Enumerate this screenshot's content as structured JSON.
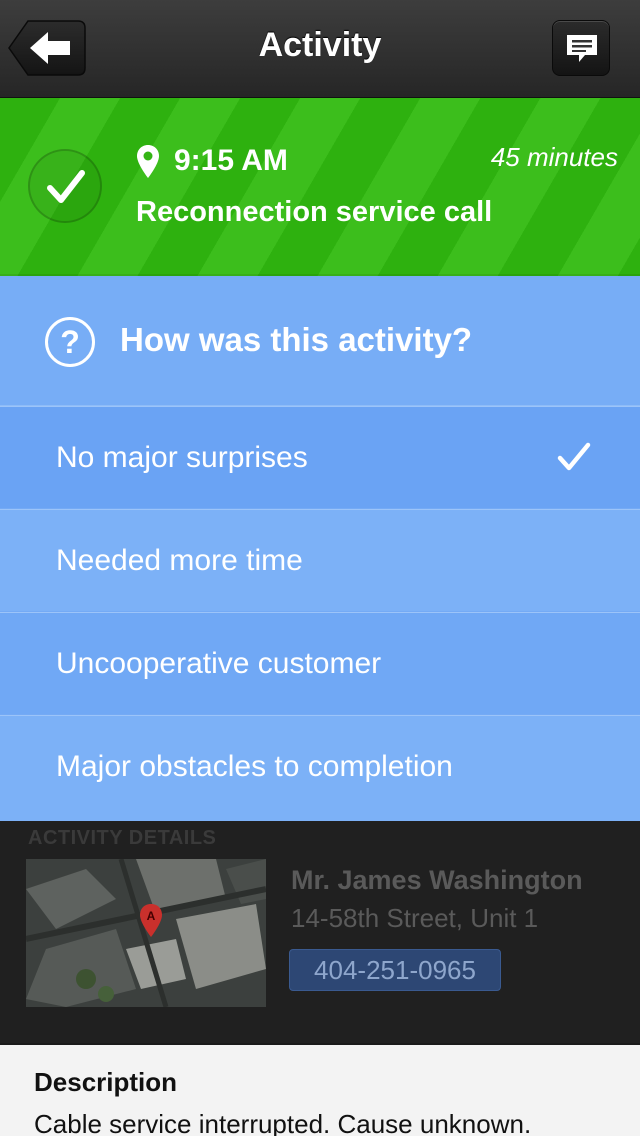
{
  "nav": {
    "title": "Activity",
    "back_icon": "arrow-left-icon",
    "message_icon": "speech-bubble-icon"
  },
  "activity": {
    "time": "9:15 AM",
    "duration": "45 minutes",
    "title": "Reconnection service call",
    "status_icon": "checkmark-icon",
    "location_icon": "map-pin-icon",
    "status_color": "#34b514"
  },
  "question": {
    "text": "How was this activity?",
    "icon": "question-icon",
    "color": "#74aaf5",
    "options": [
      {
        "label": "No major surprises",
        "selected": true
      },
      {
        "label": "Needed more time",
        "selected": false
      },
      {
        "label": "Uncooperative customer",
        "selected": false
      },
      {
        "label": "Major obstacles to completion",
        "selected": false
      }
    ]
  },
  "details": {
    "heading": "ACTIVITY DETAILS",
    "map_marker": "A",
    "customer_name": "Mr. James Washington",
    "address": "14-58th Street, Unit 1",
    "phone": "404-251-0965"
  },
  "description": {
    "label": "Description",
    "text": "Cable service interrupted. Cause unknown."
  }
}
